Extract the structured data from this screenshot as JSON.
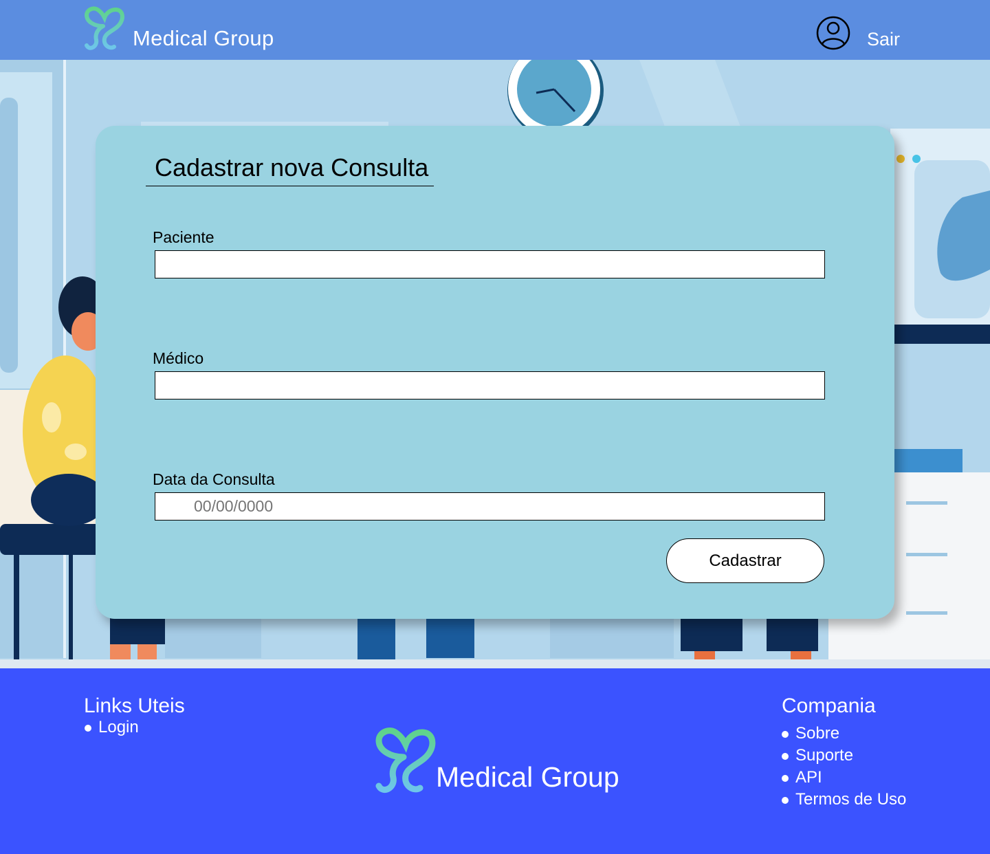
{
  "header": {
    "brand": "Medical Group",
    "logout_label": "Sair",
    "logo_icon": "heart-s-logo-icon",
    "user_icon": "user-circle-icon"
  },
  "form": {
    "title": "Cadastrar nova Consulta",
    "fields": [
      {
        "label": "Paciente",
        "value": "",
        "placeholder": ""
      },
      {
        "label": "Médico",
        "value": "",
        "placeholder": ""
      },
      {
        "label": "Data da Consulta",
        "value": "",
        "placeholder": "00/00/0000"
      }
    ],
    "submit_label": "Cadastrar"
  },
  "footer": {
    "links_title": "Links Uteis",
    "links": [
      "Login"
    ],
    "company_title": "Compania",
    "company_links": [
      "Sobre",
      "Suporte",
      "API",
      "Termos de Uso"
    ],
    "brand": "Medical Group"
  },
  "colors": {
    "header_bg": "#5b8de0",
    "card_bg": "#9ad3e1",
    "footer_bg": "#3b53ff",
    "logo_gradient_start": "#5fd38a",
    "logo_gradient_end": "#6ec6ea"
  }
}
